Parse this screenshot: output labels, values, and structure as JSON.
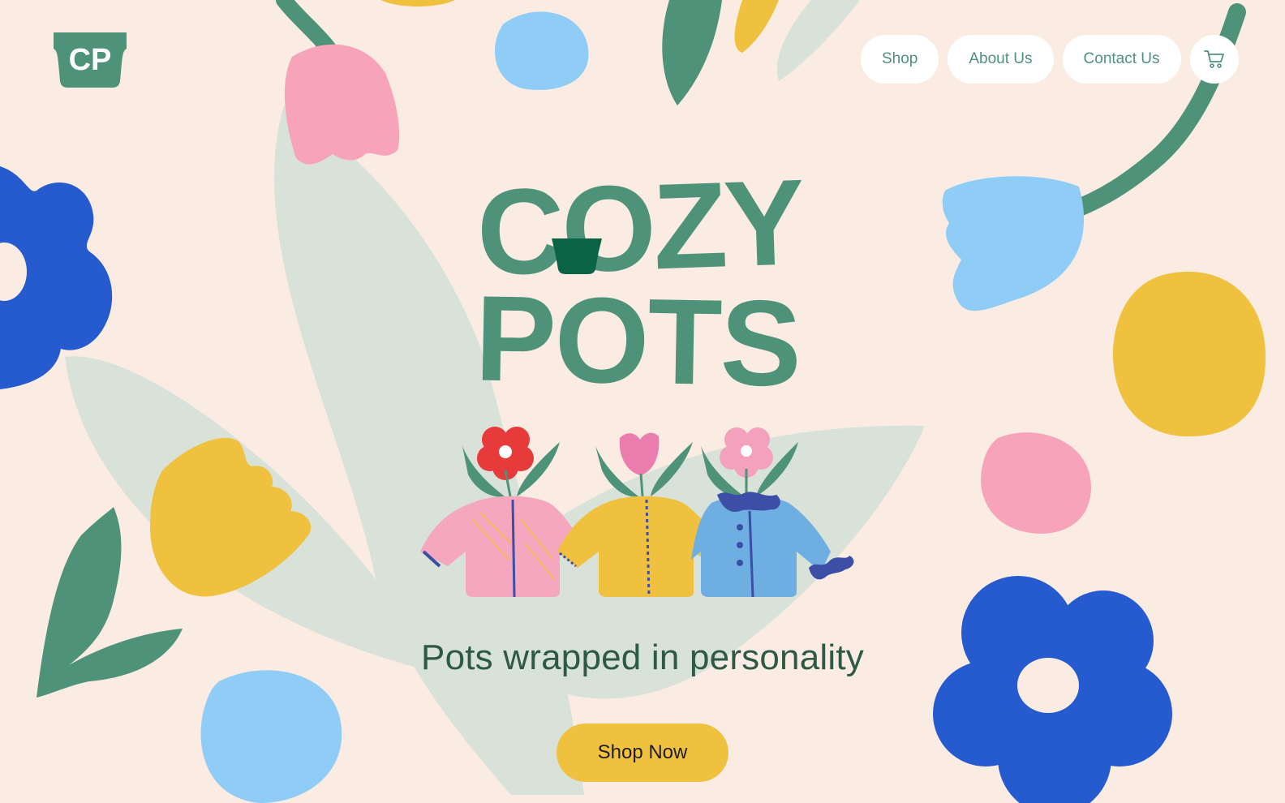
{
  "brand": {
    "logo_text": "CP",
    "title_line1": "COZY",
    "title_line2": "POTS"
  },
  "nav": {
    "items": [
      {
        "label": "Shop"
      },
      {
        "label": "About Us"
      },
      {
        "label": "Contact Us"
      }
    ],
    "cart_icon": "shopping-cart-icon"
  },
  "hero": {
    "tagline": "Pots wrapped in personality",
    "cta_label": "Shop Now"
  },
  "colors": {
    "background": "#FBECE3",
    "brand_green": "#4E9379",
    "dark_green": "#0B6346",
    "pale_leaf": "#D8E2D9",
    "pink": "#F7A3BA",
    "yellow": "#F0C13F",
    "light_blue": "#8FCDF7",
    "royal_blue": "#255BCE",
    "red": "#E73A3A",
    "tagline": "#2E5A45"
  }
}
